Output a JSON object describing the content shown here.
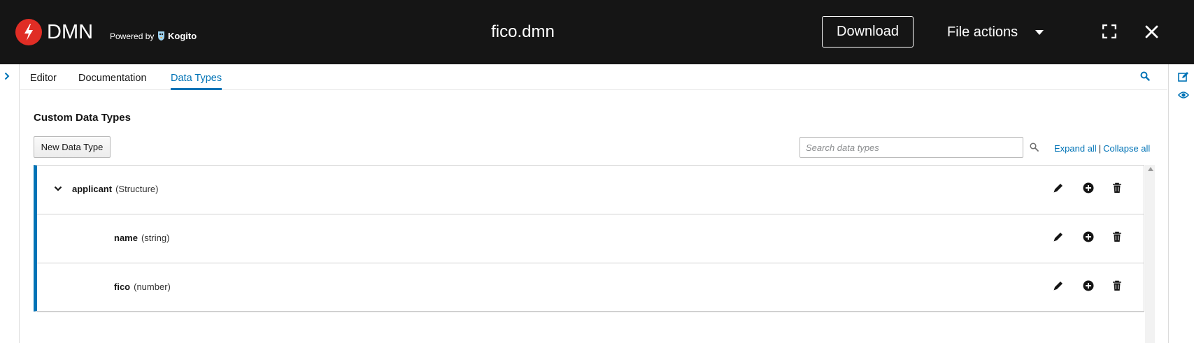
{
  "header": {
    "brand": "DMN",
    "powered_by": "Powered by",
    "kogito": "Kogito",
    "file_name": "fico.dmn",
    "download_label": "Download",
    "file_actions_label": "File actions"
  },
  "tabs": [
    {
      "label": "Editor",
      "active": false
    },
    {
      "label": "Documentation",
      "active": false
    },
    {
      "label": "Data Types",
      "active": true
    }
  ],
  "content": {
    "section_title": "Custom Data Types",
    "new_button_label": "New Data Type",
    "search_placeholder": "Search data types",
    "expand_all": "Expand all",
    "separator": "|",
    "collapse_all": "Collapse all"
  },
  "data_types": [
    {
      "name": "applicant",
      "type": "(Structure)",
      "level": 0,
      "expanded": true
    },
    {
      "name": "name",
      "type": "(string)",
      "level": 1
    },
    {
      "name": "fico",
      "type": "(number)",
      "level": 1
    }
  ],
  "colors": {
    "header_bg": "#151515",
    "accent": "#0073b6",
    "logo_red": "#e02d25"
  },
  "icons": [
    "dmn-logo-icon",
    "kogito-icon",
    "caret-down-icon",
    "expand-icon",
    "close-icon",
    "chevron-right-icon",
    "search-icon",
    "edit-icon",
    "eye-icon",
    "chevron-down-icon",
    "pencil-icon",
    "add-circle-icon",
    "trash-icon"
  ]
}
